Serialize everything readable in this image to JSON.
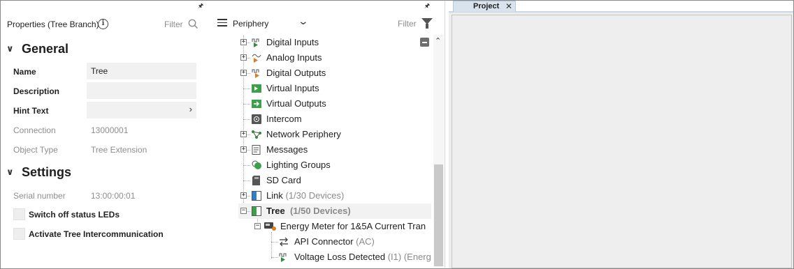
{
  "properties": {
    "title": "Properties (Tree Branch)",
    "filter_label": "Filter",
    "general": {
      "title": "General",
      "name_label": "Name",
      "name_value": "Tree",
      "description_label": "Description",
      "description_value": "",
      "hint_label": "Hint Text",
      "hint_value": "",
      "connection_label": "Connection",
      "connection_value": "13000001",
      "object_type_label": "Object Type",
      "object_type_value": "Tree Extension"
    },
    "settings": {
      "title": "Settings",
      "serial_label": "Serial number",
      "serial_value": "13:00:00:01",
      "switch_off_leds_label": "Switch off status LEDs",
      "activate_intercom_label": "Activate Tree Intercommunication"
    }
  },
  "periphery": {
    "dropdown_label": "Periphery",
    "filter_label": "Filter",
    "items": [
      {
        "label": "Digital Inputs",
        "icon": "digital-inputs-icon",
        "color": "#2e8b3a"
      },
      {
        "label": "Analog Inputs",
        "icon": "analog-inputs-icon",
        "color": "#e07b1f"
      },
      {
        "label": "Digital Outputs",
        "icon": "digital-outputs-icon",
        "color": "#e07b1f"
      },
      {
        "label": "Virtual Inputs",
        "icon": "virtual-inputs-icon",
        "color": "#3aa04a"
      },
      {
        "label": "Virtual Outputs",
        "icon": "virtual-outputs-icon",
        "color": "#3aa04a"
      },
      {
        "label": "Intercom",
        "icon": "intercom-icon",
        "color": "#555555"
      },
      {
        "label": "Network Periphery",
        "icon": "network-periphery-icon",
        "color": "#2e8b3a"
      },
      {
        "label": "Messages",
        "icon": "messages-icon",
        "color": "#555555"
      },
      {
        "label": "Lighting Groups",
        "icon": "lighting-groups-icon",
        "color": "#3aa04a"
      },
      {
        "label": "SD Card",
        "icon": "sd-card-icon",
        "color": "#555555"
      },
      {
        "label": "Link",
        "count": "(1/30 Devices)",
        "icon": "link-icon",
        "color": "#2f7fd0"
      },
      {
        "label": "Tree",
        "count": "(1/50 Devices)",
        "icon": "tree-icon",
        "color": "#3aa04a"
      },
      {
        "label": "Energy Meter for 1&5A Current Tran",
        "icon": "energy-meter-icon",
        "color": "#e07b1f"
      },
      {
        "label": "API Connector",
        "count": "(AC)",
        "icon": "api-connector-icon",
        "color": "#333333"
      },
      {
        "label": "Voltage Loss Detected",
        "count": "(I1) (Energ",
        "icon": "voltage-loss-icon",
        "color": "#2e8b3a"
      }
    ]
  },
  "project": {
    "tab_label": "Project",
    "close_glyph": "✕"
  },
  "glyphs": {
    "pin": "🖈",
    "chevron_right": "›",
    "chevron_down": "⌄",
    "section_chevron": "∨",
    "scroll_up": "⌃"
  }
}
